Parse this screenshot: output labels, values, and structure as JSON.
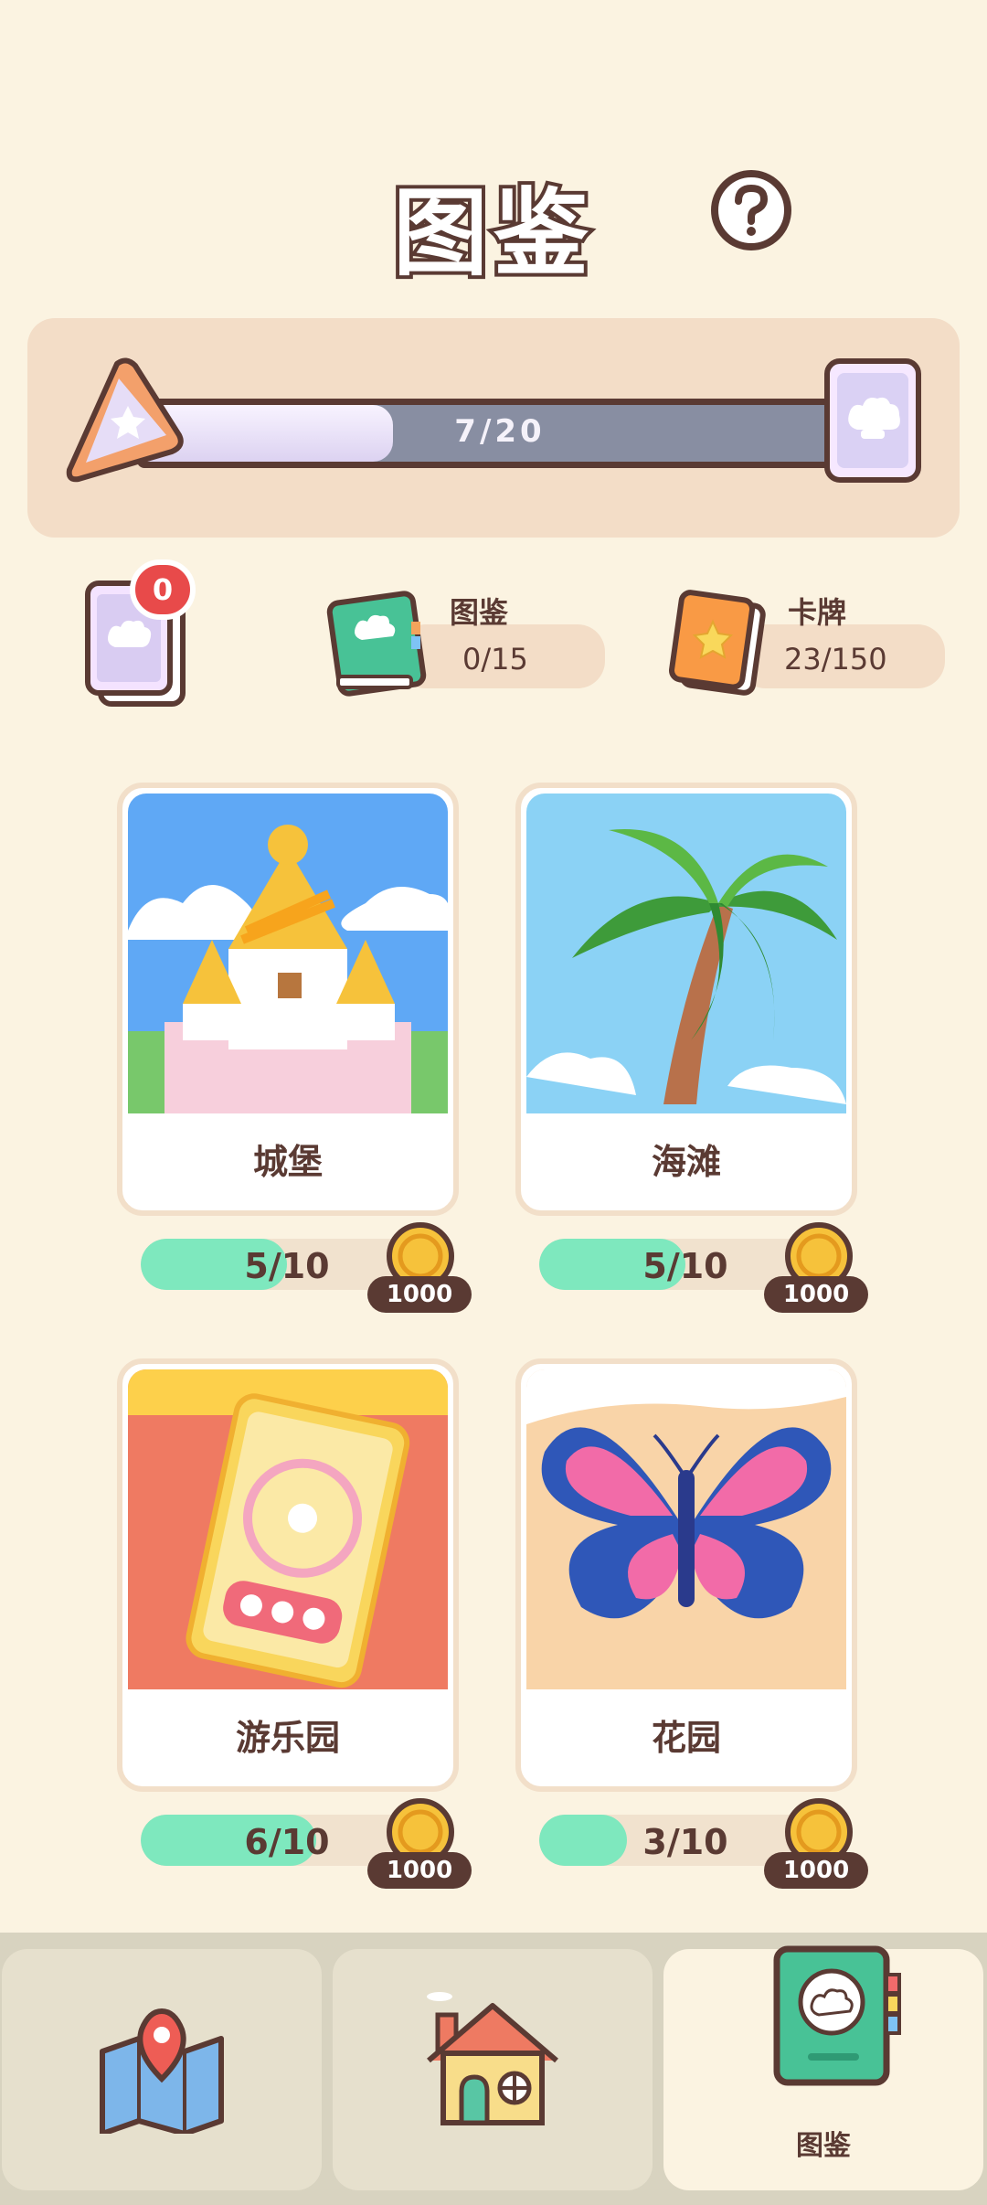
{
  "header": {
    "title": "图鉴"
  },
  "progress": {
    "current": 7,
    "total": 20,
    "text": "7/20"
  },
  "stats": {
    "pack_badge": "0",
    "album": {
      "title": "图鉴",
      "value": "0/15"
    },
    "cards": {
      "title": "卡牌",
      "value": "23/150"
    }
  },
  "collections": [
    {
      "name": "城堡",
      "progress_text": "5/10",
      "progress": 0.5,
      "reward": "1000"
    },
    {
      "name": "海滩",
      "progress_text": "5/10",
      "progress": 0.5,
      "reward": "1000"
    },
    {
      "name": "游乐园",
      "progress_text": "6/10",
      "progress": 0.6,
      "reward": "1000"
    },
    {
      "name": "花园",
      "progress_text": "3/10",
      "progress": 0.3,
      "reward": "1000"
    }
  ],
  "nav": {
    "tabs": [
      {
        "icon": "map-icon",
        "label": ""
      },
      {
        "icon": "home-icon",
        "label": ""
      },
      {
        "icon": "album-icon",
        "label": "图鉴",
        "active": true
      }
    ]
  },
  "colors": {
    "background": "#FBF3E1",
    "panel": "#F3DDC7",
    "bar_fill": "#7EE8BE",
    "dark_brown": "#5A3A33",
    "progress_track": "#888EA2"
  }
}
